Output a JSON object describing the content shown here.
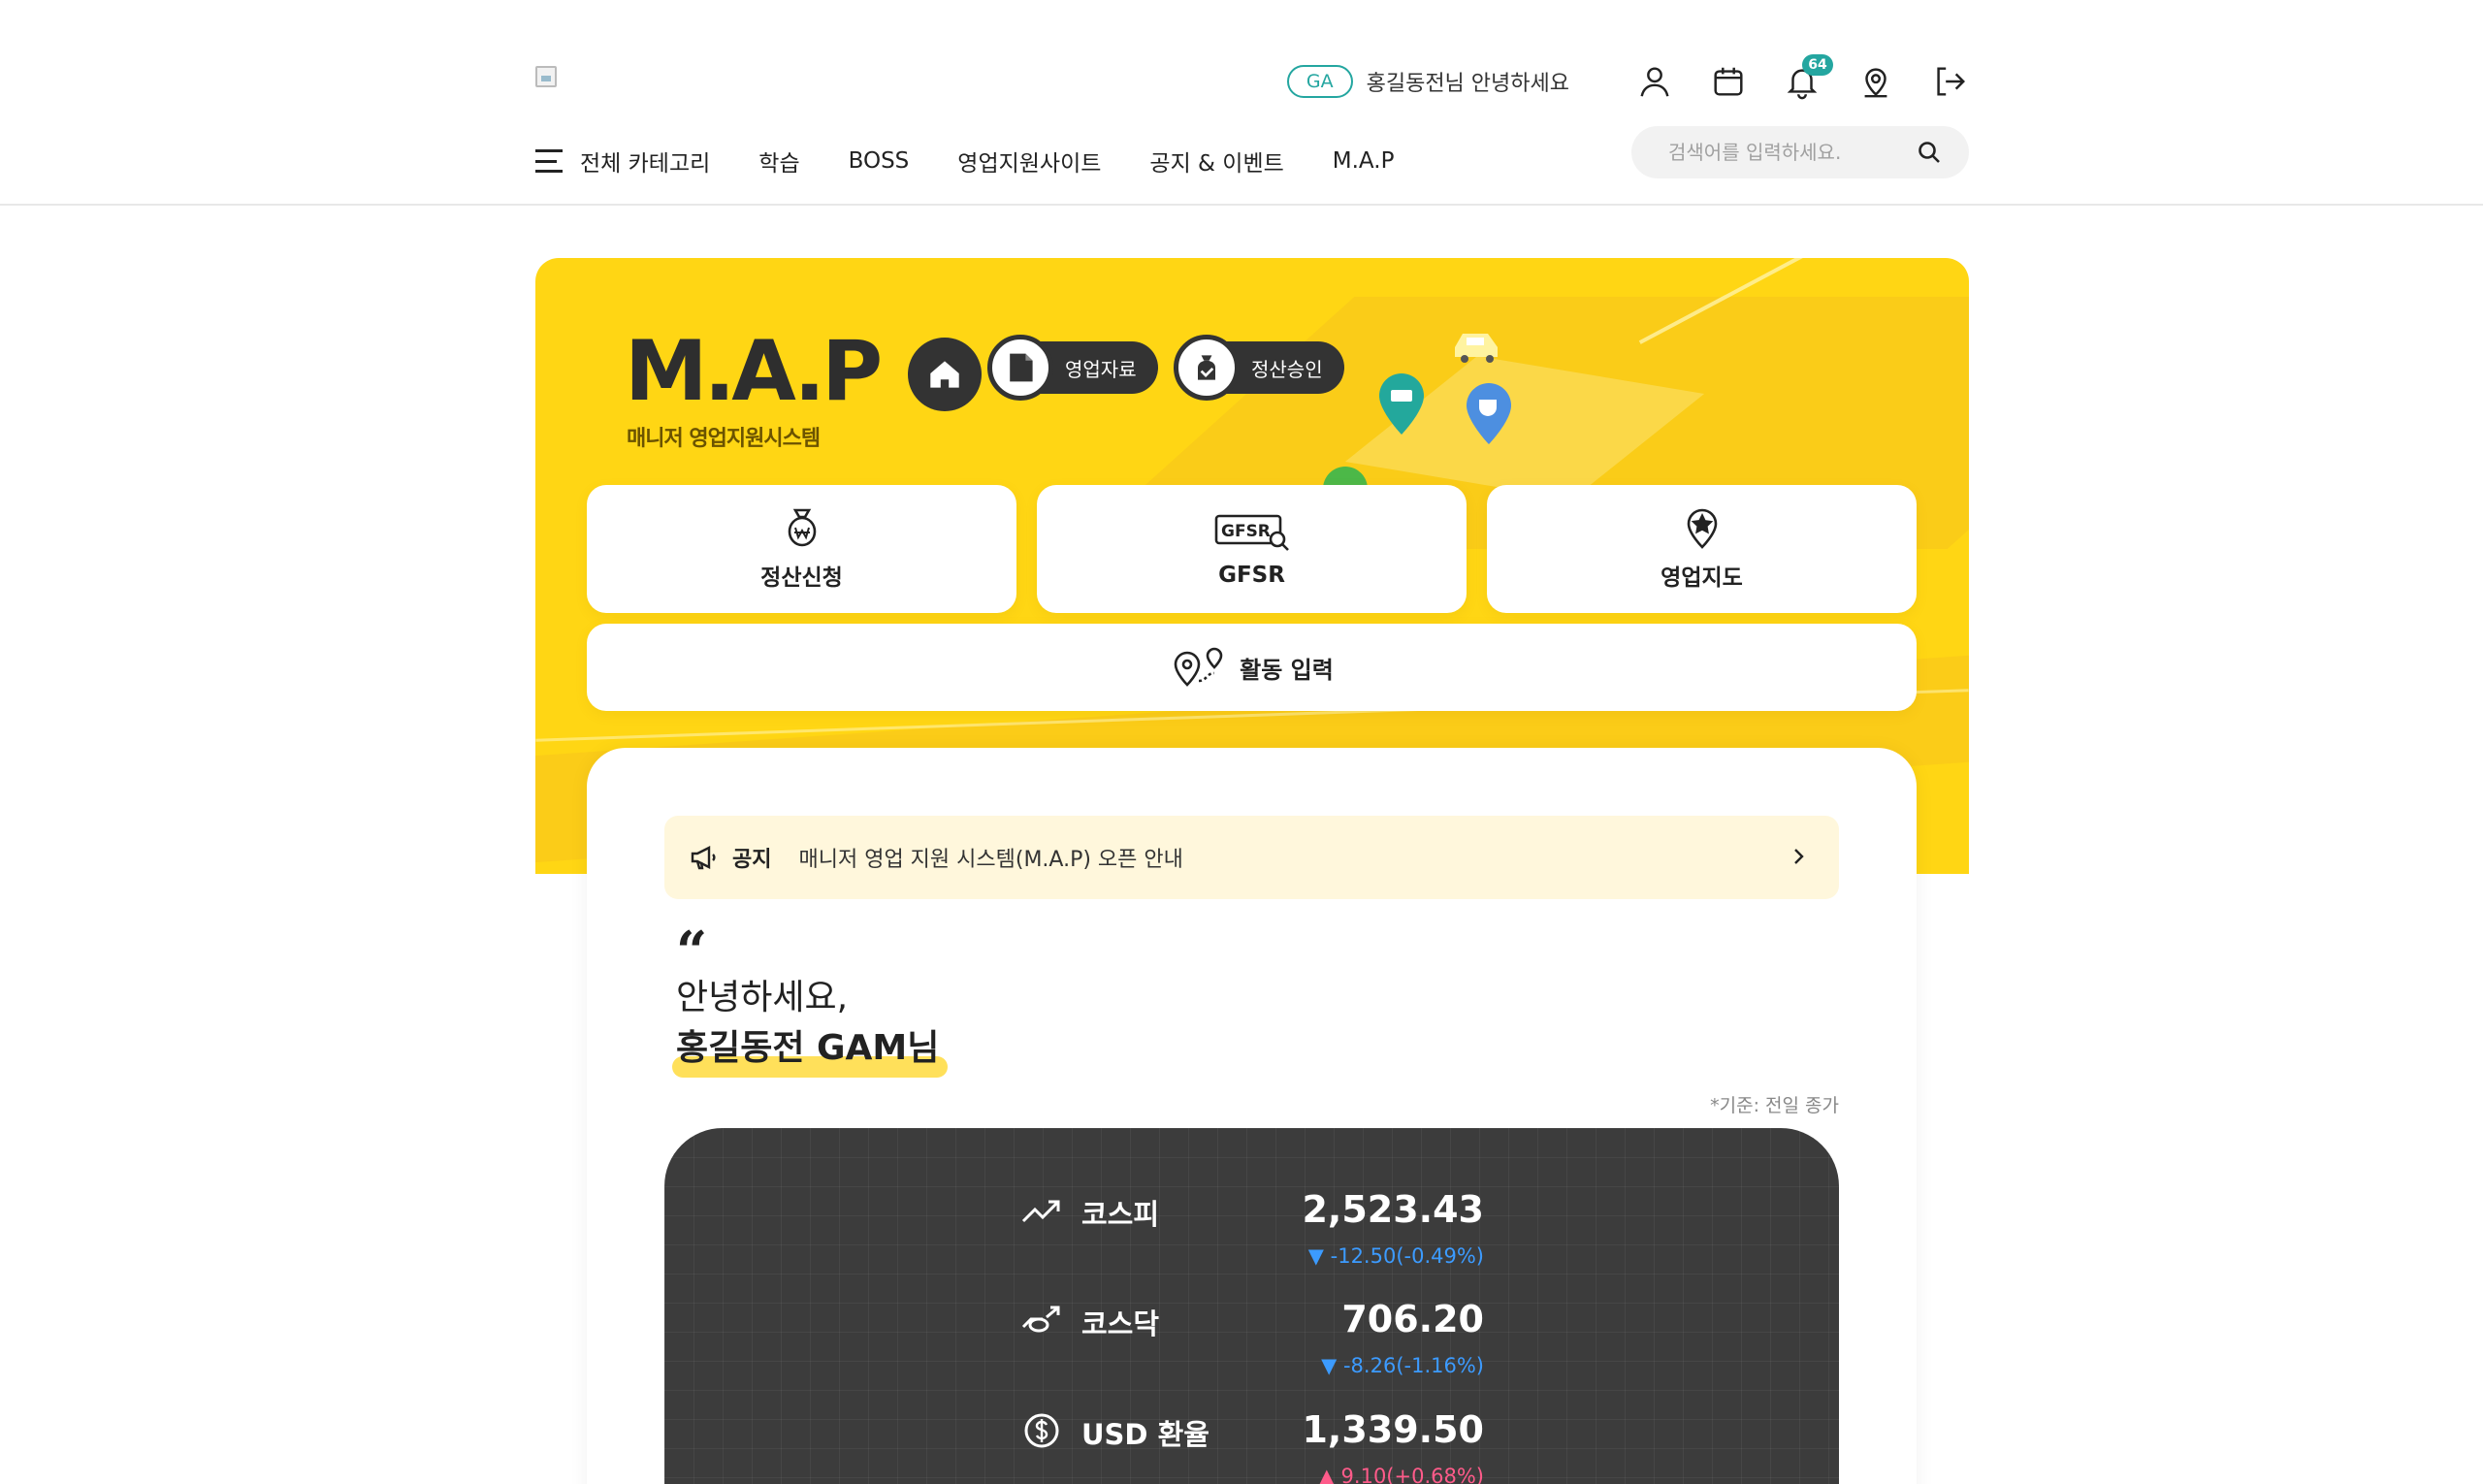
{
  "header": {
    "grade": "GA",
    "greeting": "홍길동전님 안녕하세요",
    "notification_count": "64",
    "menu_label": "전체 카테고리",
    "nav": [
      "학습",
      "BOSS",
      "영업지원사이트",
      "공지 & 이벤트",
      "M.A.P"
    ],
    "search_placeholder": "검색어를 입력하세요."
  },
  "hero": {
    "brand": "M.A.P",
    "brand_sub": "매니저 영업지원시스템",
    "pills": [
      "영업자료",
      "정산승인"
    ],
    "quick": [
      "정산신청",
      "GFSR",
      "영업지도"
    ],
    "gfsr_icon_text": "GFSR",
    "activity": "활동 입력"
  },
  "notice": {
    "tag": "공지",
    "text": "매니저 영업 지원 시스템(M.A.P) 오픈 안내"
  },
  "welcome": {
    "line1": "안녕하세요,",
    "line2": "홍길동전 GAM님",
    "basis": "*기준: 전일 종가"
  },
  "market": [
    {
      "name": "코스피",
      "value": "2,523.43",
      "change": "-12.50(-0.49%)",
      "dir": "down"
    },
    {
      "name": "코스닥",
      "value": "706.20",
      "change": "-8.26(-1.16%)",
      "dir": "down"
    },
    {
      "name": "USD 환율",
      "value": "1,339.50",
      "change": "9.10(+0.68%)",
      "dir": "up"
    }
  ],
  "colors": {
    "brand_yellow": "#ffd614",
    "teal": "#24a6a0",
    "down_blue": "#3c9bff",
    "up_pink": "#ff5b8a",
    "dark_panel": "#3c3c3c"
  }
}
